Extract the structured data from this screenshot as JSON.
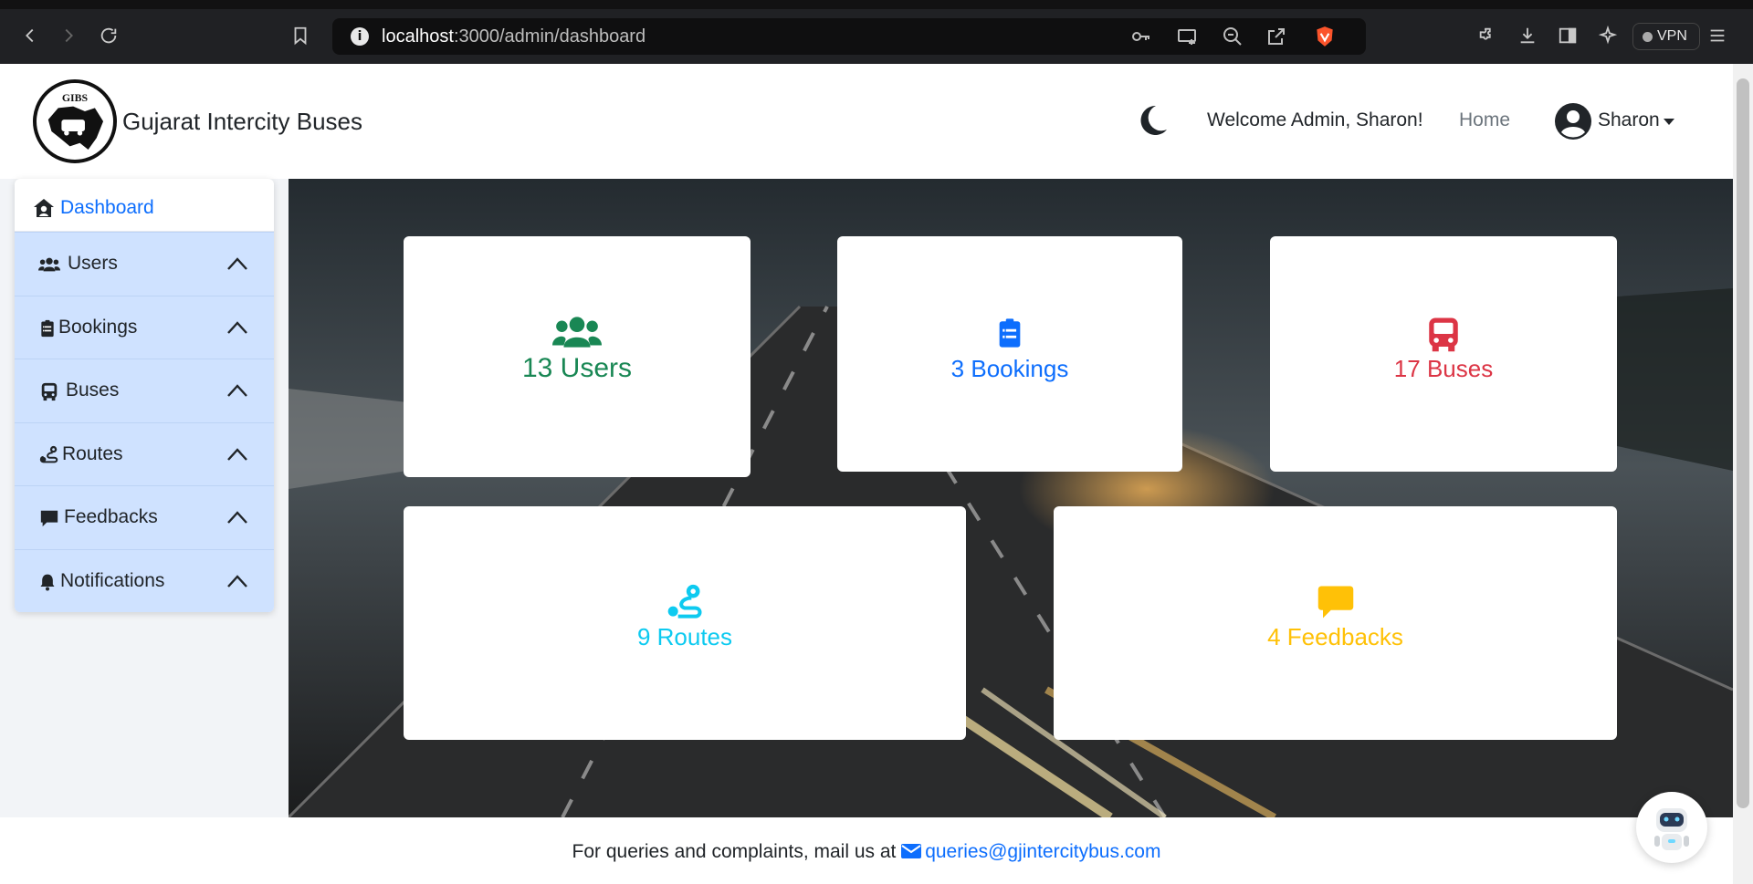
{
  "browser": {
    "url_host": "localhost",
    "url_path": ":3000/admin/dashboard",
    "vpn_label": "VPN"
  },
  "header": {
    "brand": "Gujarat Intercity Buses",
    "logo_text": "GIBS",
    "welcome": "Welcome Admin, Sharon!",
    "home": "Home",
    "user": "Sharon"
  },
  "sidebar": {
    "dashboard": "Dashboard",
    "items": [
      {
        "label": "Users",
        "icon": "users-icon"
      },
      {
        "label": "Bookings",
        "icon": "clipboard-icon"
      },
      {
        "label": "Buses",
        "icon": "bus-icon"
      },
      {
        "label": "Routes",
        "icon": "route-icon"
      },
      {
        "label": "Feedbacks",
        "icon": "message-icon"
      },
      {
        "label": "Notifications",
        "icon": "bell-icon"
      }
    ]
  },
  "cards": {
    "users": "13 Users",
    "bookings": "3 Bookings",
    "buses": "17 Buses",
    "routes": "9 Routes",
    "feedbacks": "4 Feedbacks"
  },
  "colors": {
    "users": "#198754",
    "bookings": "#0d6efd",
    "buses": "#dc3545",
    "routes": "#0dcaf0",
    "feedbacks": "#ffc107"
  },
  "footer": {
    "text": "For queries and complaints, mail us at ",
    "email": "queries@gjintercitybus.com"
  }
}
